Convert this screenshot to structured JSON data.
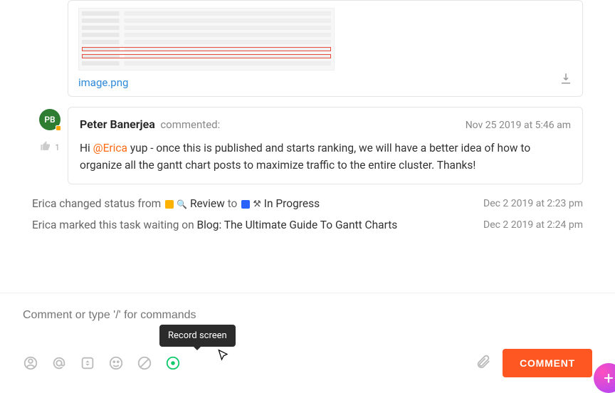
{
  "attachment": {
    "file_name": "image.png"
  },
  "comment": {
    "avatar_initials": "PB",
    "like_count": "1",
    "author": "Peter Banerjea",
    "verb": "commented:",
    "timestamp": "Nov 25 2019 at 5:46 am",
    "body_pre": "Hi ",
    "mention": "@Erica",
    "body_post": " yup - once this is published and starts ranking, we will have a better idea of how to organize all the gantt chart posts to maximize traffic to the entire cluster. Thanks!"
  },
  "activity": [
    {
      "actor": "Erica",
      "pre": " changed status from ",
      "from_label": "Review",
      "mid": " to ",
      "to_label": "In Progress",
      "timestamp": "Dec 2 2019 at 2:23 pm"
    },
    {
      "actor": "Erica",
      "pre": " marked this task waiting on ",
      "link": "Blog: The Ultimate Guide To Gantt Charts",
      "timestamp": "Dec 2 2019 at 2:24 pm"
    }
  ],
  "composer": {
    "placeholder": "Comment or type '/' for commands",
    "tooltip": "Record screen",
    "submit_label": "COMMENT"
  }
}
